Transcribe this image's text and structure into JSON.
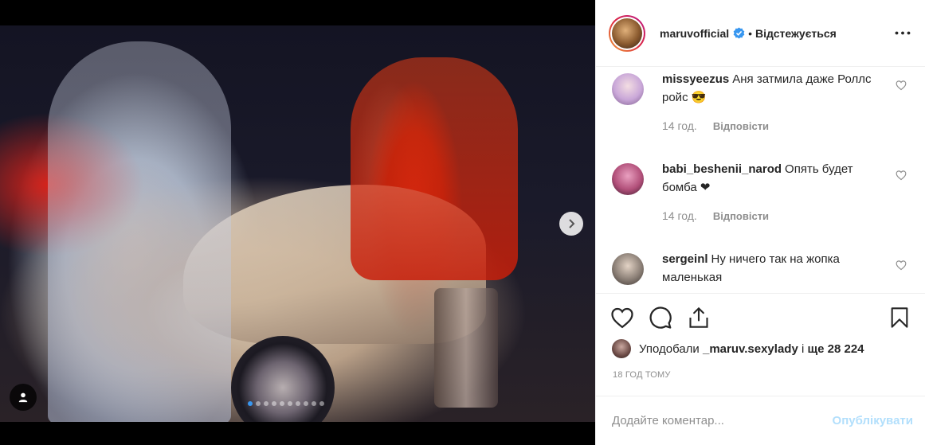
{
  "post": {
    "slides_total": 10,
    "active_slide": 1
  },
  "header": {
    "username": "maruvofficial",
    "separator": "•",
    "follow_status": "Відстежується"
  },
  "comments": [
    {
      "user": "missyeezus",
      "text": "Аня затмила даже Роллс ройс 😎",
      "time": "14 год.",
      "reply": "Відповісти",
      "avatar_color": "#c9a7d8"
    },
    {
      "user": "babi_beshenii_narod",
      "text": "Опять будет бомба ❤",
      "time": "14 год.",
      "reply": "Відповісти",
      "avatar_color": "#b2507a"
    },
    {
      "user": "sergeinl",
      "text": "Ну ничего так на жопка маленькая",
      "time": "",
      "reply": "",
      "avatar_color": "#8b7f76"
    }
  ],
  "likes": {
    "prefix": "Уподобали",
    "user": "_maruv.sexylady",
    "middle": "і",
    "count": "ще 28 224"
  },
  "timestamp": "18 ГОД ТОМУ",
  "add_comment": {
    "placeholder": "Додайте коментар...",
    "post_label": "Опублікувати"
  },
  "colors": {
    "accent": "#3897f0",
    "post_disabled": "#b2dffc",
    "muted": "#8e8e8e"
  }
}
